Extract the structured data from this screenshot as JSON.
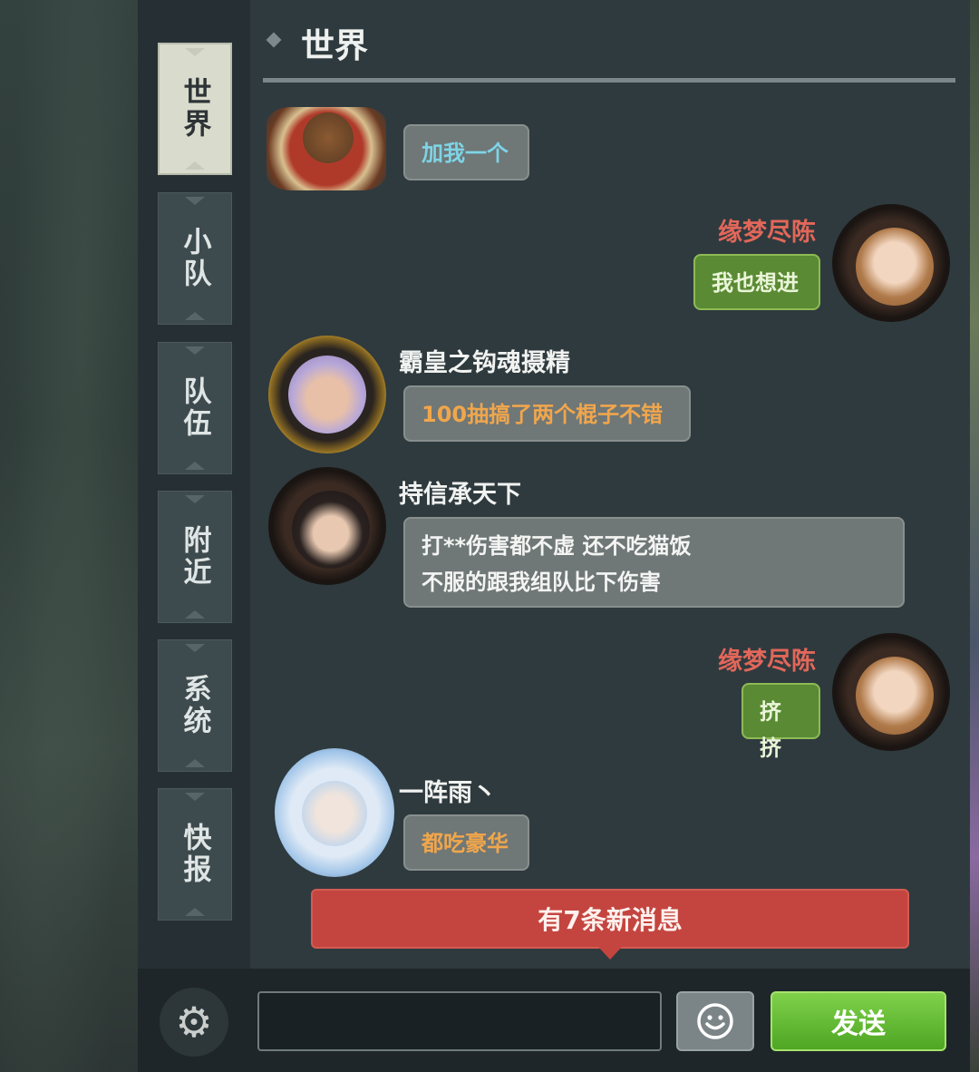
{
  "tabs": [
    {
      "label": "世界",
      "active": true
    },
    {
      "label": "小队",
      "active": false
    },
    {
      "label": "队伍",
      "active": false
    },
    {
      "label": "附近",
      "active": false
    },
    {
      "label": "系统",
      "active": false
    },
    {
      "label": "快报",
      "active": false
    }
  ],
  "header": {
    "title": "世界"
  },
  "messages": [
    {
      "sender": "",
      "text": "加我一个",
      "self": false,
      "text_color": "cyan"
    },
    {
      "sender": "缘梦尽陈",
      "text": "我也想进",
      "self": true
    },
    {
      "sender": "霸皇之钩魂摄精",
      "text": "100抽搞了两个棍子不错",
      "self": false,
      "text_color": "orange"
    },
    {
      "sender": "持信承天下",
      "lines": [
        "打**伤害都不虚 还不吃猫饭",
        "不服的跟我组队比下伤害"
      ],
      "self": false,
      "text_color": "white"
    },
    {
      "sender": "缘梦尽陈",
      "text": "挤挤",
      "self": true
    },
    {
      "sender": "一阵雨丶",
      "text": "都吃豪华",
      "self": false,
      "text_color": "orange"
    }
  ],
  "notification": {
    "text": "有7条新消息"
  },
  "input": {
    "value": "",
    "placeholder": ""
  },
  "buttons": {
    "send": "发送",
    "settings_icon": "gear-icon",
    "emoji_icon": "smiley-icon"
  },
  "colors": {
    "panel_bg": "#2f3a3e",
    "self_name": "#e2675a",
    "bubble_gray": "#6f7777",
    "bubble_green": "#5a8a34",
    "notify_red": "#c4453f",
    "send_green": "#6cc13a"
  }
}
